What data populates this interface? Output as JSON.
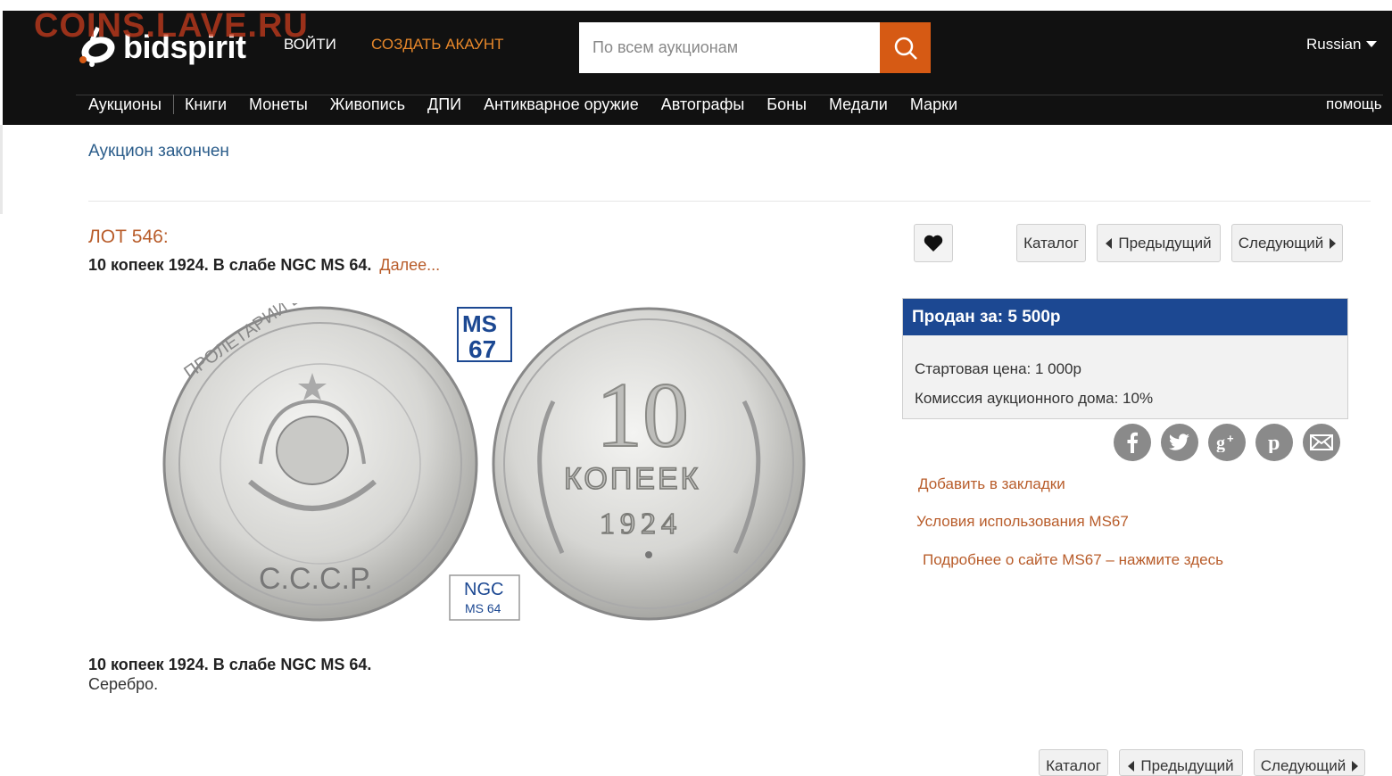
{
  "watermark": "COINS.LAVE.RU",
  "brand": "bidspirit",
  "header": {
    "login": "ВОЙТИ",
    "signup": "СОЗДАТЬ АКАУНТ",
    "search_placeholder": "По всем аукционам",
    "language": "Russian",
    "help": "помощь"
  },
  "nav": {
    "items": [
      "Аукционы",
      "Книги",
      "Монеты",
      "Живопись",
      "ДПИ",
      "Антикварное оружие",
      "Автографы",
      "Боны",
      "Медали",
      "Марки"
    ]
  },
  "status": "Аукцион закончен",
  "lot": {
    "number": "ЛОТ 546:",
    "title": "10 копеек 1924. В слабе NGC MS 64.",
    "more": "Далее...",
    "description_title": "10 копеек 1924. В слабе NGC MS 64.",
    "description_text": "Серебро."
  },
  "buttons": {
    "catalog": "Каталог",
    "previous": "Предыдущий",
    "next": "Следующий"
  },
  "price": {
    "sold": "Продан за: 5 500р",
    "start": "Стартовая цена: 1 000р",
    "commission": "Комиссия аукционного дома: 10%"
  },
  "social": [
    "facebook-icon",
    "twitter-icon",
    "google-plus-icon",
    "pinterest-icon",
    "email-icon"
  ],
  "links": {
    "bookmark": "Добавить в закладки",
    "terms": "Условия использования MS67",
    "about": "Подробнее о сайте MS67 – нажмите здесь"
  },
  "image": {
    "ms_logo_top": "MS",
    "ms_logo_bottom": "67",
    "ngc_label": "NGC",
    "grade": "MS 64",
    "reverse_value": "10",
    "reverse_word": "КОПЕЕК",
    "reverse_year": "1924",
    "obverse_legend": "ПРОЛЕТАРИИ ВСЕХ СТРАН, СОЕДИНЯЙТЕСЬ!",
    "obverse_bottom": "С.С.С.Р."
  },
  "colors": {
    "header_bg": "#111111",
    "accent_orange": "#d65a14",
    "link_brown": "#b85c2a",
    "price_blue": "#1c4892",
    "status_blue": "#2a5c8a"
  }
}
